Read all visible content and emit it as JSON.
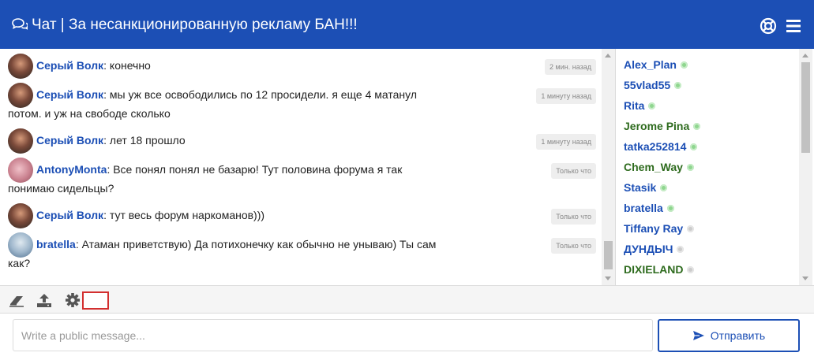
{
  "header": {
    "title": "Чат | За несанкционированную рекламу БАН!!!",
    "chat_icon": "comments-icon",
    "help_icon": "life-ring-icon",
    "menu_icon": "hamburger-menu-icon"
  },
  "messages": [
    {
      "author": "Серый Волк",
      "separator": ": ",
      "text": "конечно",
      "time": "2 мин. назад",
      "avatar": "wolf"
    },
    {
      "author": "Серый Волк",
      "separator": ": ",
      "text": "мы уж все освободились по 12 просидели. я еще 4 матанул",
      "cont": "потом. и уж на свободе сколько",
      "time": "1 минуту назад",
      "avatar": "wolf"
    },
    {
      "author": "Серый Волк",
      "separator": ": ",
      "text": "лет 18 прошло",
      "time": "1 минуту назад",
      "avatar": "wolf"
    },
    {
      "author": "AntonyMonta",
      "separator": ": ",
      "text": "Все понял понял не базарю! Тут половина форума я так",
      "cont": "понимаю сидельцы?",
      "time": "Только что",
      "avatar": "anton"
    },
    {
      "author": "Серый Волк",
      "separator": ": ",
      "text": "тут весь форум наркоманов)))",
      "time": "Только что",
      "avatar": "wolf"
    },
    {
      "author": "bratella",
      "separator": ": ",
      "text": "Атаман приветствую) Да потихонечку как обычно не унываю) Ты сам",
      "cont": "как?",
      "time": "Только что",
      "avatar": "bratella"
    }
  ],
  "users": [
    {
      "name": "Alex_Plan",
      "color": "#1c4fb5",
      "status": "online"
    },
    {
      "name": "55vlad55",
      "color": "#1c4fb5",
      "status": "online"
    },
    {
      "name": "Rita",
      "color": "#1c4fb5",
      "status": "online"
    },
    {
      "name": "Jerome Pina",
      "color": "#2e6b1e",
      "status": "online"
    },
    {
      "name": "tatka252814",
      "color": "#1c4fb5",
      "status": "online"
    },
    {
      "name": "Chem_Way",
      "color": "#2e6b1e",
      "status": "online"
    },
    {
      "name": "Stasik",
      "color": "#1c4fb5",
      "status": "online"
    },
    {
      "name": "bratella",
      "color": "#1c4fb5",
      "status": "online"
    },
    {
      "name": "Tiffany Ray",
      "color": "#1c4fb5",
      "status": "away"
    },
    {
      "name": "ДУНДЫЧ",
      "color": "#1c4fb5",
      "status": "away"
    },
    {
      "name": "DIXIELAND",
      "color": "#2e6b1e",
      "status": "away"
    }
  ],
  "toolbar": {
    "tools": [
      "eraser-icon",
      "upload-icon",
      "gear-icon"
    ]
  },
  "composer": {
    "placeholder": "Write a public message...",
    "send_label": "Отправить",
    "send_icon": "paper-plane-icon"
  },
  "colors": {
    "accent": "#1c4fb5",
    "highlight": "#d32f2f"
  }
}
